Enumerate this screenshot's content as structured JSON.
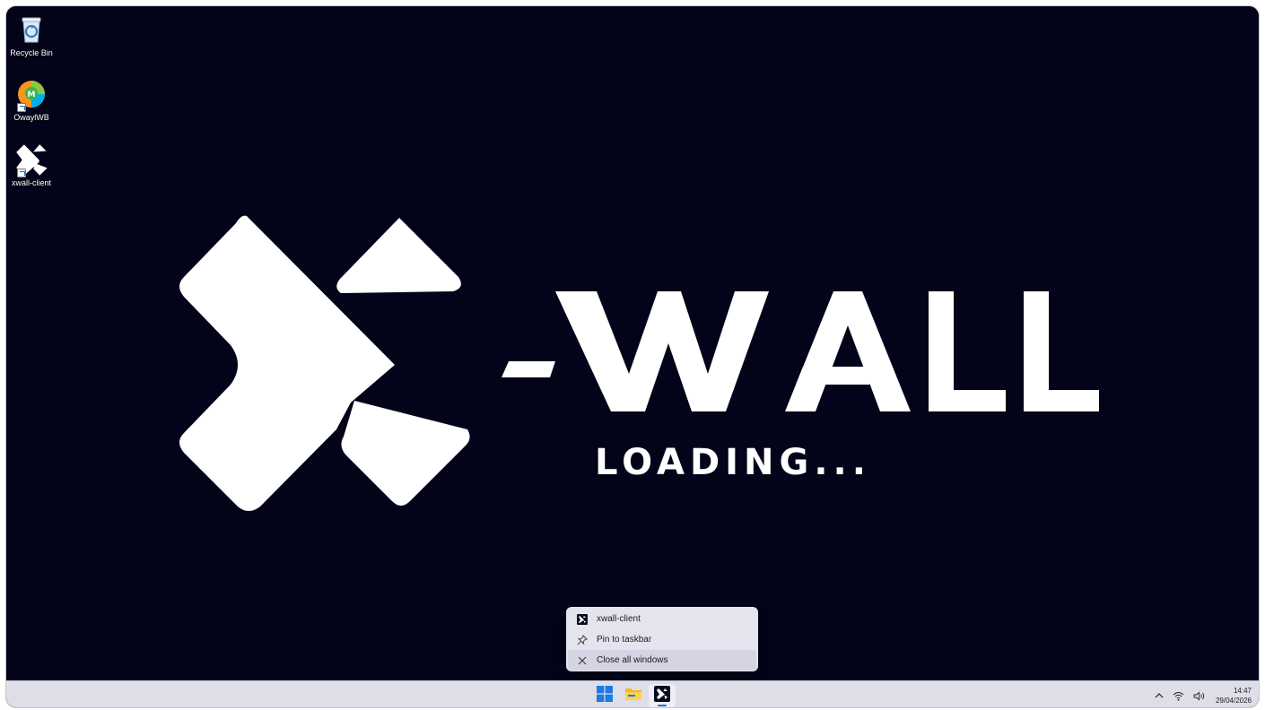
{
  "desktop": {
    "icons": [
      {
        "label": "Recycle Bin",
        "icon": "recycle-bin-icon"
      },
      {
        "label": "OwaylWB",
        "icon": "owaylwb-app-icon"
      },
      {
        "label": "xwall-client",
        "icon": "xwall-logo-icon"
      }
    ]
  },
  "splash": {
    "wordmark": "X-WALL",
    "loading": "LOADING..."
  },
  "jump_list": {
    "items": [
      {
        "label": "xwall-client",
        "icon": "xwall-logo-icon"
      },
      {
        "label": "Pin to taskbar",
        "icon": "pin-icon"
      },
      {
        "label": "Close all windows",
        "icon": "close-icon"
      }
    ]
  },
  "taskbar": {
    "apps": [
      {
        "name": "Start",
        "icon": "windows-start-icon"
      },
      {
        "name": "File Explorer",
        "icon": "folder-icon"
      },
      {
        "name": "xwall-client",
        "icon": "xwall-logo-icon",
        "active": true
      }
    ],
    "tray": {
      "time": "14:47",
      "date": "29/04/2026"
    }
  },
  "colors": {
    "desktop_bg": "#03031a",
    "taskbar_bg": "#dedee8",
    "accent": "#1f6fd1",
    "logo": "#ffffff"
  }
}
